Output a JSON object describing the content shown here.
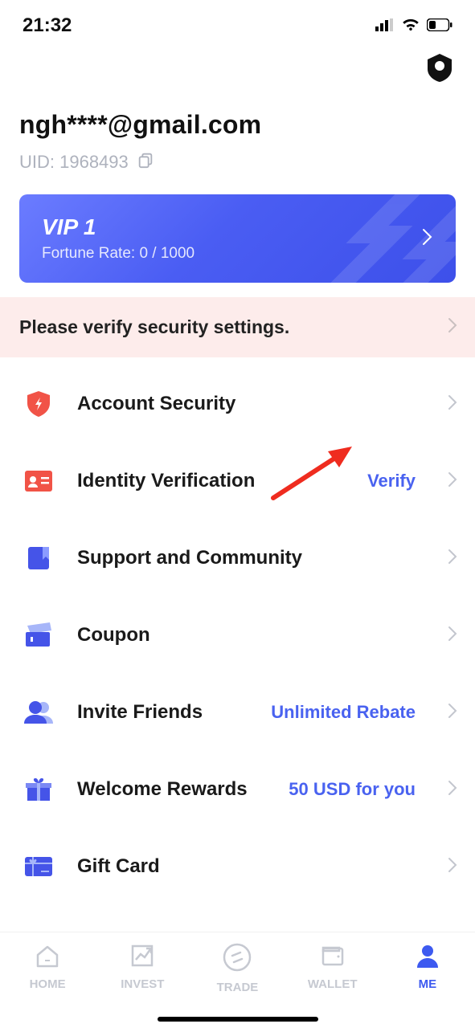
{
  "statusbar": {
    "time": "21:32"
  },
  "header": {
    "email": "ngh****@gmail.com",
    "uid_label": "UID: 1968493"
  },
  "vipcard": {
    "title": "VIP 1",
    "subtitle": "Fortune Rate: 0 / 1000"
  },
  "banner": {
    "text": "Please verify security settings."
  },
  "menu": {
    "account_security": {
      "label": "Account Security"
    },
    "identity_verification": {
      "label": "Identity Verification",
      "accent": "Verify"
    },
    "support": {
      "label": "Support and Community"
    },
    "coupon": {
      "label": "Coupon"
    },
    "invite_friends": {
      "label": "Invite Friends",
      "accent": "Unlimited Rebate"
    },
    "welcome_rewards": {
      "label": "Welcome Rewards",
      "accent": "50 USD for you"
    },
    "gift_card": {
      "label": "Gift Card"
    }
  },
  "nav": {
    "home": "HOME",
    "invest": "INVEST",
    "trade": "TRADE",
    "wallet": "WALLET",
    "me": "ME"
  }
}
